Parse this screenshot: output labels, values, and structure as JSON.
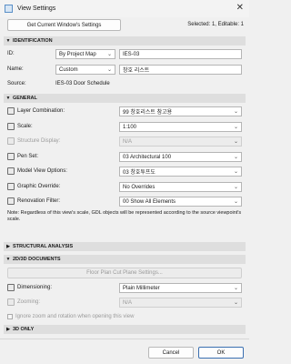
{
  "window": {
    "title": "View Settings",
    "close_glyph": "✕",
    "icon": "app-icon"
  },
  "top": {
    "get_settings_label": "Get Current Window's Settings",
    "selected_info": "Selected: 1, Editable: 1"
  },
  "sections": {
    "identification": "IDENTIFICATION",
    "general": "GENERAL",
    "structural": "STRUCTURAL ANALYSIS",
    "docs": "2D/3D DOCUMENTS",
    "three_d": "3D ONLY"
  },
  "identification": {
    "id_label": "ID:",
    "id_mode": "By Project Map",
    "id_value": "IES-03",
    "name_label": "Name:",
    "name_mode": "Custom",
    "name_value": "창호 리스트",
    "source_label": "Source:",
    "source_value": "IES-03 Door Schedule"
  },
  "general": {
    "layer_label": "Layer Combination:",
    "layer_value": "99 창호리스트 참고용",
    "scale_label": "Scale:",
    "scale_value": "1:100",
    "structure_label": "Structure Display:",
    "structure_value": "N/A",
    "pen_label": "Pen Set:",
    "pen_value": "03 Architectural 100",
    "mvo_label": "Model View Options:",
    "mvo_value": "03 창호투프도",
    "graphic_label": "Graphic Override:",
    "graphic_value": "No Overrides",
    "reno_label": "Renovation Filter:",
    "reno_value": "00 Show All Elements",
    "note": "Note: Regardless of this view's scale, GDL objects will be represented according to the source viewpoint's scale."
  },
  "docs": {
    "cut_plane_label": "Floor Plan Cut Plane Settings...",
    "dim_label": "Dimensioning:",
    "dim_value": "Plain Millimeter",
    "zoom_label": "Zooming:",
    "zoom_value": "N/A",
    "ignore_label": "Ignore zoom and rotation when opening this view"
  },
  "footer": {
    "cancel_label": "Cancel",
    "ok_label": "OK"
  },
  "glyphs": {
    "collapsed": "▶",
    "expanded": "▼",
    "chevron": "⌄"
  }
}
